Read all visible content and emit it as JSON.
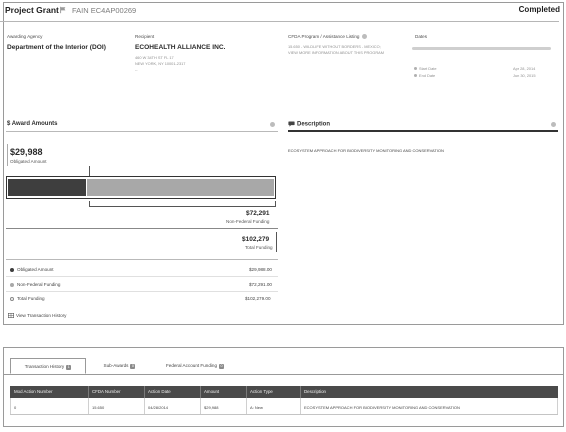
{
  "header": {
    "title": "Project Grant",
    "fain": "FAIN EC4AP00269",
    "status": "Completed"
  },
  "overview": {
    "awarding_agency_label": "Awarding Agency",
    "awarding_agency_value": "Department of the Interior (DOI)",
    "recipient_label": "Recipient",
    "recipient_value": "ECOHEALTH ALLIANCE INC.",
    "recipient_address_1": "460 W 34TH ST FL 17",
    "recipient_address_2": "NEW YORK, NY 10001-2317",
    "recipient_address_3": "--",
    "cfda_label": "CFDA Program / Assistance Listing",
    "cfda_value_1": "15.650 - WILDLIFE WITHOUT BORDERS - MEXICO;",
    "cfda_value_2": "VIEW MORE INFORMATION ABOUT THIS PROGRAM",
    "dates_label": "Dates",
    "start_label": "Start Date",
    "start_value": "Apr 28, 2014",
    "end_label": "End Date",
    "end_value": "Jun 30, 2015"
  },
  "award_amounts": {
    "heading": "$ Award Amounts",
    "obligated_amount": "$29,988",
    "obligated_label": "Obligated Amount",
    "non_federal_amount": "$72,291",
    "non_federal_label": "Non-Federal Funding",
    "total_amount": "$102,279",
    "total_label": "Total Funding",
    "obligated_fraction": 0.293,
    "legend": [
      {
        "label": "Obligated Amount",
        "value": "$29,988.00",
        "color": "#3e3e3e"
      },
      {
        "label": "Non-Federal Funding",
        "value": "$72,291.00",
        "color": "#a8a8a8"
      },
      {
        "label": "Total Funding",
        "value": "$102,279.00",
        "color": "#ffffff"
      }
    ],
    "history_link": "View Transaction History"
  },
  "description": {
    "heading": "Description",
    "text": "ECOSYSTEM APPROACH FOR BIODIVERSITY MONITORING AND CONSERVATION"
  },
  "tabs": [
    {
      "label": "Transaction History",
      "badge": "1"
    },
    {
      "label": "Sub-Awards",
      "badge": "0"
    },
    {
      "label": "Federal Account Funding",
      "badge": "0"
    }
  ],
  "table": {
    "headers": [
      "Mod Action Number",
      "CFDA Number",
      "Action Date",
      "Amount",
      "Action Type",
      "Description"
    ],
    "rows": [
      [
        "0",
        "15.650",
        "04/28/2014",
        "$29,988",
        "A: New",
        "ECOSYSTEM APPROACH FOR BIODIVERSITY MONITORING AND CONSERVATION"
      ]
    ]
  }
}
